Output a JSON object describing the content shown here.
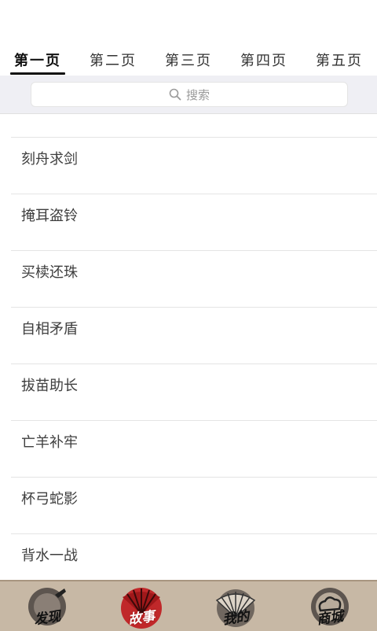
{
  "tabs": [
    {
      "label": "第一页",
      "active": true
    },
    {
      "label": "第二页",
      "active": false
    },
    {
      "label": "第三页",
      "active": false
    },
    {
      "label": "第四页",
      "active": false
    },
    {
      "label": "第五页",
      "active": false
    }
  ],
  "search": {
    "placeholder": "搜索",
    "icon": "search-icon"
  },
  "list": {
    "items": [
      "刻舟求剑",
      "掩耳盗铃",
      "买椟还珠",
      "自相矛盾",
      "拔苗助长",
      "亡羊补牢",
      "杯弓蛇影",
      "背水一战"
    ]
  },
  "bottom_nav": {
    "items": [
      {
        "label": "发现",
        "icon": "ink-circle-icon",
        "active": false
      },
      {
        "label": "故事",
        "icon": "red-fan-icon",
        "active": true
      },
      {
        "label": "我的",
        "icon": "fan-icon",
        "active": false
      },
      {
        "label": "商城",
        "icon": "cloud-circle-icon",
        "active": false
      }
    ]
  },
  "colors": {
    "nav_background": "#c7b8a5",
    "accent_red": "#c0282a",
    "search_bar_bg": "#efeff4"
  }
}
